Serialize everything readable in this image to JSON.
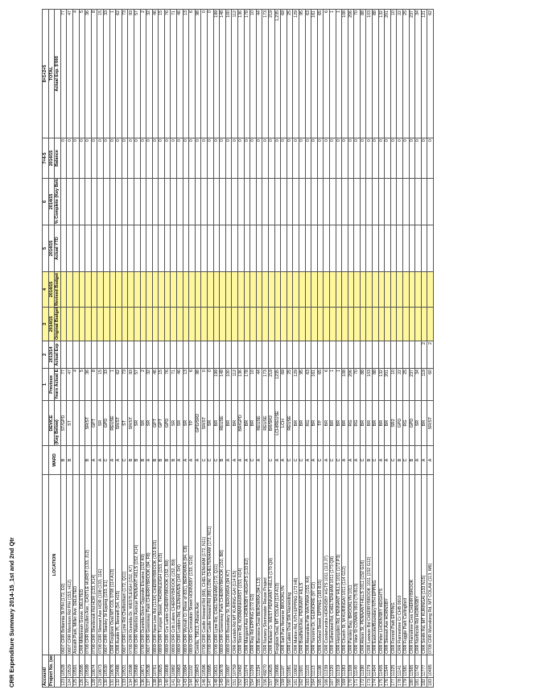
{
  "title": "CRR Expenditure Summary 2014-15_1st and 2nd Qtr",
  "headers": {
    "account": "Account/",
    "project": "Project No. (work orders)",
    "location": "LOCATION",
    "ward": "WARD",
    "device": "DEVICE",
    "key_below": "(Key Below)",
    "col1_num": "1",
    "col1_title": "Previous",
    "col1_sub": "Years Actual Exp",
    "col2_num": "2",
    "col2_year": "2013/14",
    "col2_sub": "Actual Exp",
    "col3_num": "3",
    "col3_year": "2014/15",
    "col3_sub": "Original Budget",
    "col4_num": "4",
    "col4_year": "2014/15",
    "col4_sub": "Revised Budget",
    "col5_num": "5",
    "col5_year": "2014/15",
    "col5_sub": "Actual YTD",
    "col6_num": "6",
    "col6_year": "2014/15",
    "col6_sub": "% Complete (Key Below )",
    "col7_num": "7=4-5",
    "col7_year": "2014/15",
    "col7_sub": "Balance",
    "col8_num": "8=1+2+5",
    "col8_title": "TOTAL",
    "col8_sub": "Actual Exp. $'000"
  },
  "rows": [
    {
      "n": "123",
      "acct": "10528",
      "loc": "0607 CRR Britannia St P/H (172, D2)",
      "ward": "B",
      "dev": "ST/GPD",
      "prev": "77",
      "a13": "",
      "bal": "0",
      "tot": "77"
    },
    {
      "n": "124",
      "acct": "10529",
      "loc": "0607 CRR Morrison Rd P/H (153, H12)",
      "ward": "B",
      "dev": "ST",
      "prev": "47",
      "a13": "",
      "bal": "0",
      "tot": "47"
    },
    {
      "n": "125",
      "acct": "10591",
      "loc": "Anorath Park, Miller Ave. DELETED",
      "ward": "",
      "dev": "",
      "prev": "4",
      "a13": "",
      "bal": "0",
      "tot": "4"
    },
    {
      "n": "126",
      "acct": "10595",
      "loc": "CRR Millstream Grove. DELETED",
      "ward": "",
      "dev": "",
      "prev": "5",
      "a13": "",
      "bal": "0",
      "tot": "5"
    },
    {
      "n": "127",
      "acct": "10599",
      "loc": "0708 CRR Mcmullen Ave., CASTLE HURST (133, J12)",
      "ward": "B",
      "dev": "SR/ST",
      "prev": "36",
      "a13": "",
      "bal": "0",
      "tot": "36"
    },
    {
      "n": "128",
      "acct": "10674",
      "loc": "0708 CRR Sherbrook Rd HOR (133, K14)",
      "ward": "A",
      "dev": "GPT",
      "prev": "8",
      "a13": "",
      "bal": "0",
      "tot": "8"
    },
    {
      "n": "129",
      "acct": "10673",
      "loc": "0708 CRR Stewart Ave HOR (108 (133, 11E)",
      "ward": "A",
      "dev": "SR",
      "prev": "15",
      "a13": "",
      "bal": "0",
      "tot": "15"
    },
    {
      "n": "130",
      "acct": "10530",
      "loc": "0607 CRR Stanley St Epping (153, E1)",
      "ward": "C",
      "dev": "GPD",
      "prev": "33",
      "a13": "",
      "bal": "0",
      "tot": "33"
    },
    {
      "n": "131",
      "acct": "10676",
      "loc": "CRR Foxglove Oval MT COL 0708 (114 A13)",
      "ward": "A",
      "dev": "REUSE",
      "prev": "1",
      "a13": "",
      "bal": "0",
      "tot": "1"
    },
    {
      "n": "132",
      "acct": "10486",
      "loc": "CRR Austin Pl, Bennett (54, H15)",
      "ward": "A",
      "dev": "SR/ST",
      "prev": "62",
      "a13": "",
      "bal": "0",
      "tot": "62"
    },
    {
      "n": "133",
      "acct": "10531",
      "loc": "0607 CRR Lyne Rd Cheltenham (172, Q11)",
      "ward": "C",
      "dev": "ST",
      "prev": "73",
      "a13": "",
      "bal": "0",
      "tot": "73"
    },
    {
      "n": "134",
      "acct": "10598",
      "loc": "0708 CRR Dunelda Dr. WESTLEIGH (152, K7)",
      "ward": "B",
      "dev": "SR/ST",
      "prev": "93",
      "a13": "",
      "bal": "0",
      "tot": "93"
    },
    {
      "n": "135",
      "acct": "10568",
      "loc": "0708 CRR Waterloo Avenue PENNANT HILLS (152, K14)",
      "ward": "B",
      "dev": "SR",
      "prev": "57",
      "a13": "",
      "bal": "0",
      "tot": "57"
    },
    {
      "n": "136",
      "acct": "10671",
      "loc": "0708 CRR Dunelda Drive Opposite Elouera (152 K9)",
      "ward": "B",
      "dev": "SR",
      "prev": "2",
      "a13": "",
      "bal": "0",
      "tot": "2"
    },
    {
      "n": "137",
      "acct": "10538",
      "loc": "0607 CRR Greenway Park CHERRYBROOK (94, F8)",
      "ward": "A",
      "dev": "SR",
      "prev": "32",
      "a13": "",
      "bal": "0",
      "tot": "32"
    },
    {
      "n": "138",
      "acct": "10761",
      "loc": "0809 CRR New Line Rd (113X) CHERRYBROOK (152 B15)",
      "ward": "B",
      "dev": "GPT",
      "prev": "46",
      "a13": "",
      "bal": "0",
      "tot": "46"
    },
    {
      "n": "139",
      "acct": "10825",
      "loc": "0809 CRR Trumper Street, THORNLEIGH (153, B15)",
      "ward": "B",
      "dev": "GPT",
      "prev": "15",
      "a13": "",
      "bal": "0",
      "tot": "15"
    },
    {
      "n": "140",
      "acct": "10808",
      "loc": "0809 CRR Cnr Larkin CHERRYBROOK (152, B9)",
      "ward": "B",
      "dev": "GPD",
      "prev": "76",
      "a13": "",
      "bal": "0",
      "tot": "76"
    },
    {
      "n": "141",
      "acct": "10982",
      "loc": "0809 CRR Crib Lakes CHERRYBROOK (152, B9)",
      "ward": "B",
      "dev": "SR",
      "prev": "71",
      "a13": "",
      "bal": "0",
      "tot": "71"
    },
    {
      "n": "142",
      "acct": "10983",
      "loc": "0809 CRR Loddon Rd, GLENHAVEN (144, D4)",
      "ward": "A",
      "dev": "SR",
      "prev": "46",
      "a13": "",
      "bal": "0",
      "tot": "46"
    },
    {
      "n": "143",
      "acct": "10994",
      "loc": "0809 CRR Wymah Cr (Rear of 831), BEROWRA (94, C8)",
      "ward": "A",
      "dev": "SR",
      "prev": "13",
      "a13": "",
      "bal": "0",
      "tot": "13"
    },
    {
      "n": "144",
      "acct": "11102",
      "loc": "0809 CRR Coronation Street HORNSBY (133, G16)",
      "ward": "A",
      "dev": "TP",
      "prev": "6",
      "a13": "",
      "bal": "0",
      "tot": "6"
    },
    {
      "n": "145",
      "acct": "10843",
      "loc": "Corella, T5613, Albaria Ave",
      "ward": "A",
      "dev": "GPD/SR2",
      "prev": "98",
      "a13": "",
      "bal": "0",
      "tot": "98"
    },
    {
      "n": "146",
      "acct": "10596",
      "loc": "0708 CRR Castle Howard Rd (69), CHELTENHAM (172, N11)",
      "ward": "C",
      "dev": "SR/ST",
      "prev": "0",
      "a13": "",
      "bal": "0",
      "tot": "0"
    },
    {
      "n": "147",
      "acct": "10995",
      "loc": "0708 CRR Castle Howard Rd (89) LOW, CHELTENHAM (172, N11)",
      "ward": "C",
      "dev": "SR",
      "prev": "0",
      "a13": "",
      "bal": "0",
      "tot": "0"
    },
    {
      "n": "148",
      "acct": "10631",
      "loc": "0708 CRR Lyne Rd, CHELTENHAM (172, Q11)",
      "ward": "C",
      "dev": "BR",
      "prev": "199",
      "a13": "",
      "bal": "0",
      "tot": "199"
    },
    {
      "n": "149",
      "acct": "10678",
      "loc": "0809 CRR Greenway Park CHERRYBROOK (152, B8)",
      "ward": "B",
      "dev": "REUSE",
      "prev": "148",
      "a13": "",
      "bal": "0",
      "tot": "148"
    },
    {
      "n": "150",
      "acct": "10997",
      "loc": "0809 CRR Boundary St, BEROWRA (94 K7)",
      "ward": "A",
      "dev": "BR",
      "prev": "100",
      "a13": "",
      "bal": "0",
      "tot": "100"
    },
    {
      "n": "151",
      "acct": "10759",
      "loc": "CRR Gundah Rd MT KURING-GAI (114 E5)",
      "ward": "A",
      "dev": "BR",
      "prev": "112",
      "a13": "",
      "bal": "0",
      "tot": "112"
    },
    {
      "n": "152",
      "acct": "10482",
      "loc": "CRR Storm Rd, NORMANHURST (153, H14)",
      "ward": "A",
      "dev": "BR/GPD",
      "prev": "136",
      "a13": "",
      "bal": "0",
      "tot": "136"
    },
    {
      "n": "153",
      "acct": "11074",
      "loc": "CRR Margaret Ave HORNSBY HEIGHTS (133 E2)",
      "ward": "A",
      "dev": "BR",
      "prev": "178",
      "a13": "",
      "bal": "0",
      "tot": "178"
    },
    {
      "n": "154",
      "acct": "11209",
      "loc": "CRR Ray Rd EPPING (172 G3)",
      "ward": "C",
      "dev": "BR",
      "prev": "10",
      "a13": "",
      "bal": "0",
      "tot": "10"
    },
    {
      "n": "155",
      "acct": "11234",
      "loc": "CRR Berowra Oval BEROWRA (94 L13)",
      "ward": "A",
      "dev": "REUSE",
      "prev": "44",
      "a13": "",
      "bal": "0",
      "tot": "44"
    },
    {
      "n": "156",
      "acct": "49270",
      "loc": "CRR Nursery Stormwater Reuse Project",
      "ward": "",
      "dev": "REUSE",
      "prev": "173",
      "a13": "",
      "bal": "0",
      "tot": "173"
    },
    {
      "n": "157",
      "acct": "10625",
      "loc": "CRR Ballast Cr. WEST PENNANT HILLS (170 Q9)",
      "ward": "C",
      "dev": "BR/SR2",
      "prev": "219",
      "a13": "",
      "bal": "0",
      "tot": "219"
    },
    {
      "n": "158",
      "acct": "10666",
      "loc": "Foxglove Oval, MT COLAH (114 A13)",
      "ward": "A",
      "dev": "LCH/REUSE",
      "prev": "1235",
      "a13": "",
      "bal": "0",
      "tot": "1,235"
    },
    {
      "n": "159",
      "acct": "11197",
      "loc": "CRR Salt Pan Reserve BROOKLYN",
      "ward": "A",
      "dev": "LCH",
      "prev": "69",
      "a13": "",
      "bal": "0",
      "tot": "69"
    },
    {
      "n": "160",
      "acct": "11081",
      "loc": "CRR Lakes Oval SW Harvesting",
      "ward": "C",
      "dev": "REUSE",
      "prev": "25",
      "a13": "",
      "bal": "0",
      "tot": "25"
    },
    {
      "n": "161",
      "acct": "10902",
      "loc": "CRR Malton Rd, NTH EPPING (173 H6)",
      "ward": "C",
      "dev": "BR",
      "prev": "129",
      "a13": "",
      "bal": "0",
      "tot": "129"
    },
    {
      "n": "162",
      "acct": "11601",
      "loc": "CRR Bradfield Ave, PENNANT HILLS",
      "ward": "C",
      "dev": "BR",
      "prev": "95",
      "a13": "",
      "bal": "0",
      "tot": "95"
    },
    {
      "n": "163",
      "acct": "11103",
      "loc": "CRR Alexandria Pde WAITARA (153, K4)",
      "ward": "A",
      "dev": "RG",
      "prev": "63",
      "a13": "",
      "bal": "0",
      "tot": "63"
    },
    {
      "n": "164",
      "acct": "11113",
      "loc": "CRR Yarrome Dr, GLENORIE (97 C2)",
      "ward": "A",
      "dev": "BR",
      "prev": "161",
      "a13": "",
      "bal": "0",
      "tot": "161"
    },
    {
      "n": "165",
      "acct": "11198",
      "loc": "CRR Oxford Street, EPPING (193 B15)",
      "ward": "C",
      "dev": "TP",
      "prev": "65",
      "a13": "",
      "bal": "0",
      "tot": "65"
    },
    {
      "n": "166",
      "acct": "11239",
      "loc": "CRR Coolamundra HORNSBY HGTS 1011 (113 J7)",
      "ward": "A",
      "dev": "BR",
      "prev": "6",
      "a13": "",
      "bal": "0",
      "tot": "6"
    },
    {
      "n": "167",
      "acct": "11220",
      "loc": "CRR Sutherland Rd, CHELTENHAM 1011 (173 Q9)",
      "ward": "C",
      "dev": "BR",
      "prev": "1",
      "a13": "",
      "bal": "0",
      "tot": "1"
    },
    {
      "n": "168",
      "acct": "11319",
      "loc": "CRR Hampden Rd, PENNANT HILLS 1011 (172 P3)",
      "ward": "C",
      "dev": "BR",
      "prev": "1",
      "a13": "",
      "bal": "0",
      "tot": "1"
    },
    {
      "n": "169",
      "acct": "11283",
      "loc": "CRR Church St, M KURINGAI 1011 (114 G12)",
      "ward": "A",
      "dev": "BR",
      "prev": "108",
      "a13": "",
      "bal": "0",
      "tot": "108"
    },
    {
      "n": "170",
      "acct": "11308",
      "loc": "CRR Parsley Bay, BROOKLYN 1011",
      "ward": "A",
      "dev": "RG",
      "prev": "206",
      "a13": "",
      "bal": "0",
      "tot": "206"
    },
    {
      "n": "171",
      "acct": "11140",
      "loc": "CRR View St COWAN 0910 (75 B13)",
      "ward": "A",
      "dev": "RG",
      "prev": "70",
      "a13": "",
      "bal": "0",
      "tot": "70"
    },
    {
      "n": "172",
      "acct": "11290",
      "loc": "CRR Alison St, PENNANT HILLS 1011 (152 G16)",
      "ward": "C",
      "dev": "BR",
      "prev": "88",
      "a13": "",
      "bal": "0",
      "tot": "88"
    },
    {
      "n": "173",
      "acct": "11279",
      "loc": "CRR Lawson Rd CHERRYBROOK 1011 (152 G12)",
      "ward": "B",
      "dev": "BR",
      "prev": "103",
      "a13": "",
      "bal": "0",
      "tot": "103"
    },
    {
      "n": "174",
      "acct": "11404",
      "loc": "CRR Eastcote/Boundary NTH EPPING",
      "ward": "C",
      "dev": "BR",
      "prev": "88",
      "a13": "",
      "bal": "0",
      "tot": "88"
    },
    {
      "n": "175",
      "acct": "11405",
      "loc": "CRR Peter LHORNSBY HEIGHTS",
      "ward": "A",
      "dev": "BR",
      "prev": "132",
      "a13": "",
      "bal": "0",
      "tot": "132"
    },
    {
      "n": "176",
      "acct": "11544",
      "loc": "CRR Stewart Ave HORNSBY",
      "ward": "A",
      "dev": "BR",
      "prev": "201",
      "a13": "",
      "bal": "0",
      "tot": "201"
    },
    {
      "n": "177",
      "acct": "11225",
      "loc": "CRR Forrest Park EPPING",
      "ward": "C",
      "dev": "SR2",
      "prev": "10",
      "a13": "",
      "bal": "0",
      "tot": "10"
    },
    {
      "n": "178",
      "acct": "11141",
      "loc": "CRR Flamestree Cr CHB 0910",
      "ward": "B",
      "dev": "GPD",
      "prev": "22",
      "a13": "",
      "bal": "0",
      "tot": "22"
    },
    {
      "n": "179",
      "acct": "11581",
      "loc": "CRR Fuggle Park Carlingford",
      "ward": "C",
      "dev": "RG",
      "prev": "25",
      "a13": "",
      "bal": "0",
      "tot": "25"
    },
    {
      "n": "180",
      "acct": "11565",
      "loc": "CRR Flametree Cres CHERRYBROOK",
      "ward": "B",
      "dev": "GPD",
      "prev": "237",
      "a13": "",
      "bal": "0",
      "tot": "237"
    },
    {
      "n": "181",
      "acct": "11742",
      "loc": "CRR Northcote Rd HORNSBY",
      "ward": "A",
      "dev": "SR",
      "prev": "34",
      "a13": "",
      "bal": "0",
      "tot": "34"
    },
    {
      "n": "182",
      "acct": "11777",
      "loc": "CRR Smith Rd, MT KURINGAI (133 N15)",
      "ward": "A",
      "dev": "BR",
      "prev": "119",
      "a13": "2",
      "bal": "0",
      "tot": "121"
    },
    {
      "n": "183",
      "acct": "10485",
      "loc": "0708 CRR Murralong Rd, MT COLAH (113, M6)",
      "ward": "A",
      "dev": "SR/ST",
      "prev": "60",
      "a13": "2",
      "bal": "0",
      "tot": "62"
    }
  ]
}
